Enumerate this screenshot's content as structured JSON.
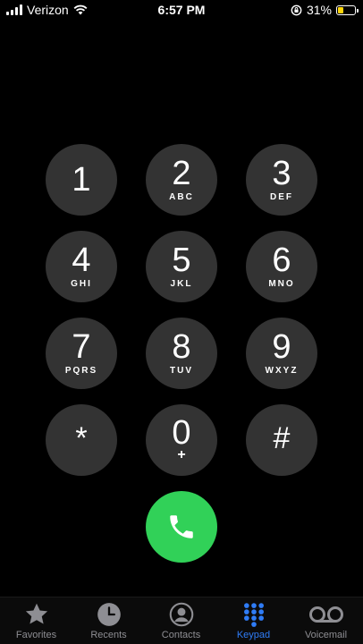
{
  "status_bar": {
    "carrier": "Verizon",
    "time": "6:57 PM",
    "battery": "31%",
    "battery_level": 0.31,
    "battery_color": "#ffd60a"
  },
  "keypad": {
    "keys": [
      {
        "digit": "1",
        "letters": ""
      },
      {
        "digit": "2",
        "letters": "ABC"
      },
      {
        "digit": "3",
        "letters": "DEF"
      },
      {
        "digit": "4",
        "letters": "GHI"
      },
      {
        "digit": "5",
        "letters": "JKL"
      },
      {
        "digit": "6",
        "letters": "MNO"
      },
      {
        "digit": "7",
        "letters": "PQRS"
      },
      {
        "digit": "8",
        "letters": "TUV"
      },
      {
        "digit": "9",
        "letters": "WXYZ"
      },
      {
        "digit": "*",
        "letters": ""
      },
      {
        "digit": "0",
        "letters": "+"
      },
      {
        "digit": "#",
        "letters": ""
      }
    ],
    "key_color": "#333333"
  },
  "call_button": {
    "icon": "phone-icon",
    "color": "#31d158"
  },
  "tab_bar": {
    "active_color": "#2f7cf6",
    "tabs": [
      {
        "label": "Favorites",
        "icon": "star-icon"
      },
      {
        "label": "Recents",
        "icon": "clock-icon"
      },
      {
        "label": "Contacts",
        "icon": "person-circle-icon"
      },
      {
        "label": "Keypad",
        "icon": "keypad-grid-icon",
        "active": true
      },
      {
        "label": "Voicemail",
        "icon": "voicemail-icon"
      }
    ]
  }
}
